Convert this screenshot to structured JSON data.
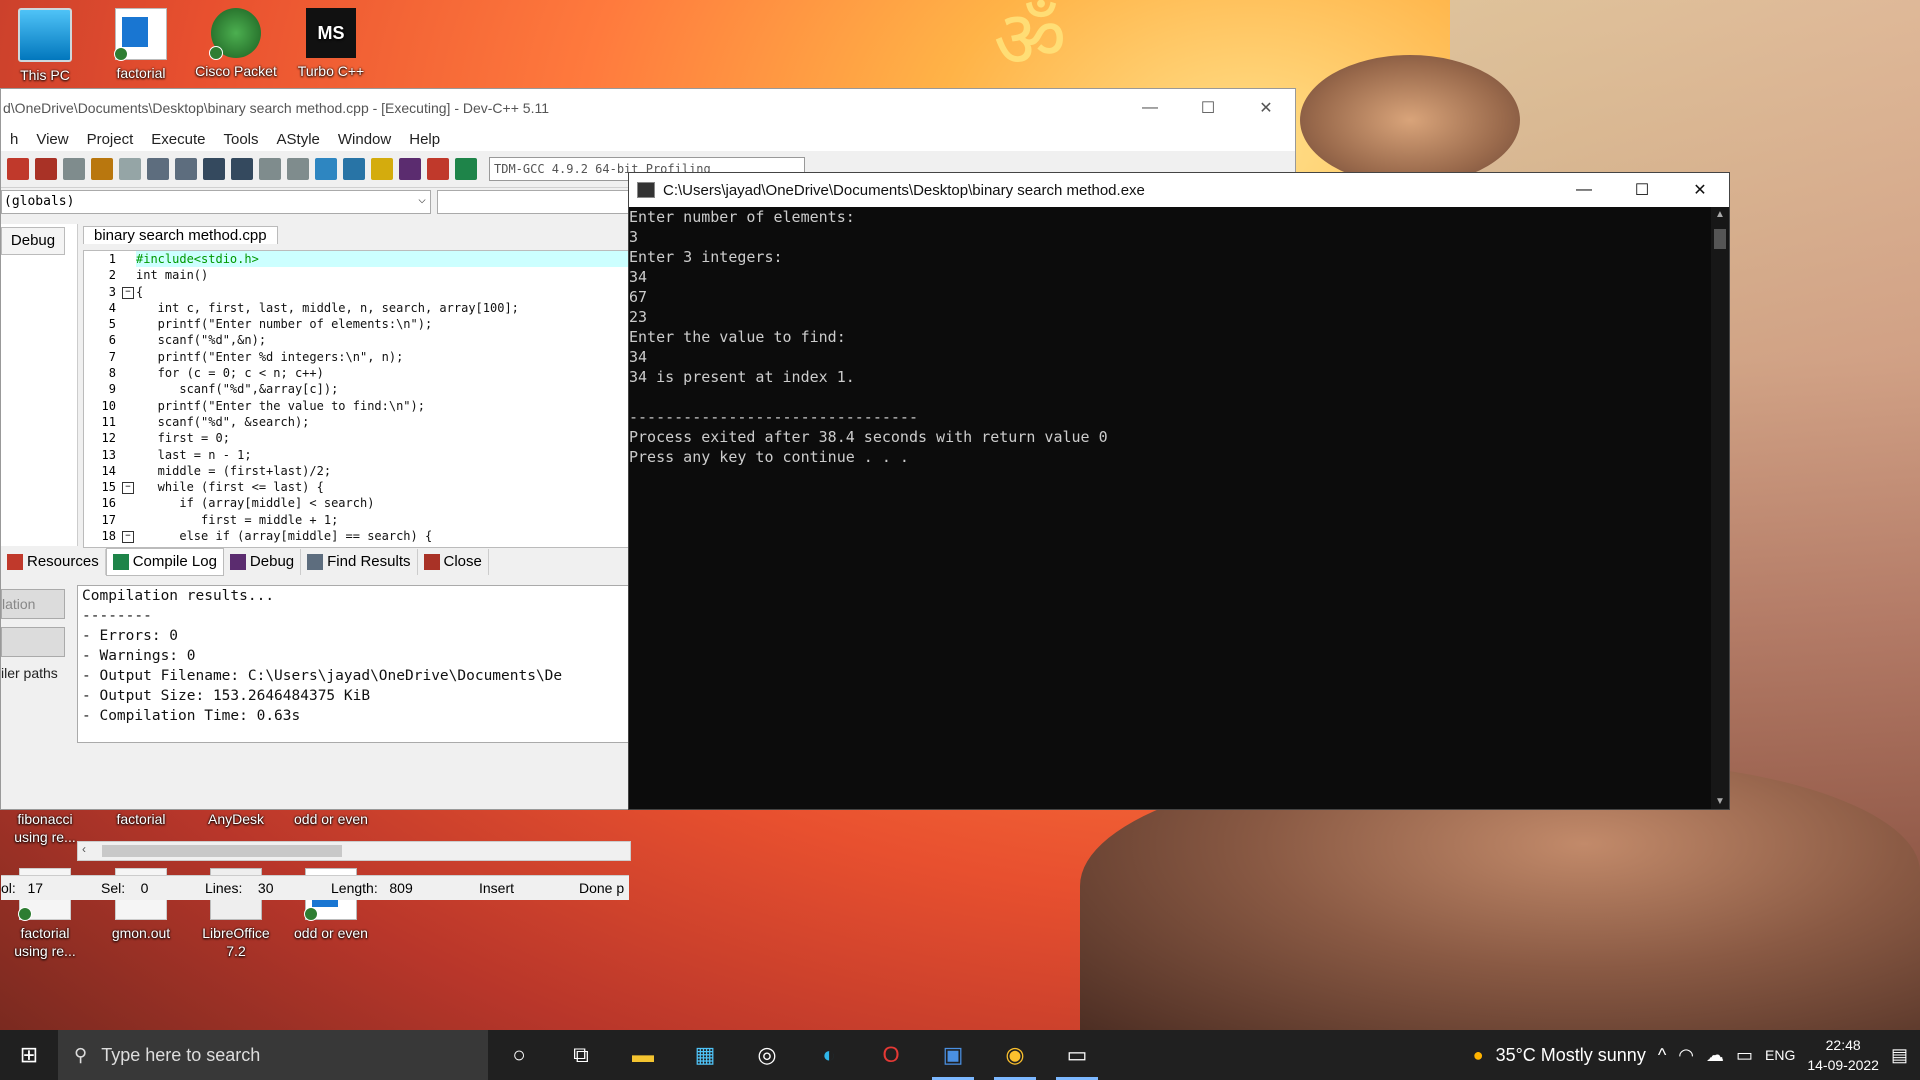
{
  "desktop": {
    "icons_top": [
      {
        "label": "This PC",
        "icon": "computer-icon"
      },
      {
        "label": "factorial",
        "icon": "document-icon"
      },
      {
        "label": "Cisco Packet",
        "icon": "cisco-icon"
      },
      {
        "label": "Turbo C++",
        "icon": "turbo-cpp-icon"
      }
    ],
    "icons_mid": [
      {
        "label": "fibonacci using re...",
        "icon": "file-icon"
      },
      {
        "label": "factorial",
        "icon": "file-icon"
      },
      {
        "label": "AnyDesk",
        "icon": "anydesk-icon"
      },
      {
        "label": "odd or even",
        "icon": "file-icon"
      }
    ],
    "icons_bottom": [
      {
        "label": "factorial using re...",
        "icon": "devcpp-file-icon"
      },
      {
        "label": "gmon.out",
        "icon": "file-icon"
      },
      {
        "label": "LibreOffice 7.2",
        "icon": "libreoffice-icon"
      },
      {
        "label": "odd or even",
        "icon": "document-icon"
      }
    ]
  },
  "devcpp": {
    "title": "d\\OneDrive\\Documents\\Desktop\\binary search method.cpp - [Executing] - Dev-C++ 5.11",
    "menu": [
      "h",
      "View",
      "Project",
      "Execute",
      "Tools",
      "AStyle",
      "Window",
      "Help"
    ],
    "compiler": "TDM-GCC 4.9.2 64-bit Profiling",
    "globals": "(globals)",
    "left_tab": "Debug",
    "editor_tab": "binary search method.cpp",
    "line_numbers": [
      "1",
      "2",
      "3",
      "4",
      "5",
      "6",
      "7",
      "8",
      "9",
      "10",
      "11",
      "12",
      "13",
      "14",
      "15",
      "16",
      "17",
      "18"
    ],
    "code_lines": [
      "#include<stdio.h>",
      "int main()",
      "{",
      "   int c, first, last, middle, n, search, array[100];",
      "   printf(\"Enter number of elements:\\n\");",
      "   scanf(\"%d\",&n);",
      "   printf(\"Enter %d integers:\\n\", n);",
      "   for (c = 0; c < n; c++)",
      "      scanf(\"%d\",&array[c]);",
      "   printf(\"Enter the value to find:\\n\");",
      "   scanf(\"%d\", &search);",
      "   first = 0;",
      "   last = n - 1;",
      "   middle = (first+last)/2;",
      "   while (first <= last) {",
      "      if (array[middle] < search)",
      "         first = middle + 1;",
      "      else if (array[middle] == search) {"
    ],
    "bottom_tabs": [
      "Resources",
      "Compile Log",
      "Debug",
      "Find Results",
      "Close"
    ],
    "bottom_left": [
      "lation",
      "iler paths"
    ],
    "compile_log": [
      "Compilation results...",
      "--------",
      "- Errors: 0",
      "- Warnings: 0",
      "- Output Filename: C:\\Users\\jayad\\OneDrive\\Documents\\De",
      "- Output Size: 153.2646484375 KiB",
      "- Compilation Time: 0.63s"
    ],
    "status": {
      "col": "ol:   17",
      "sel": "Sel:    0",
      "lines": "Lines:    30",
      "length": "Length:   809",
      "mode": "Insert",
      "done": "Done p"
    }
  },
  "console": {
    "title": "C:\\Users\\jayad\\OneDrive\\Documents\\Desktop\\binary search method.exe",
    "lines": [
      "Enter number of elements:",
      "3",
      "Enter 3 integers:",
      "34",
      "67",
      "23",
      "Enter the value to find:",
      "34",
      "34 is present at index 1.",
      "",
      "--------------------------------",
      "Process exited after 38.4 seconds with return value 0",
      "Press any key to continue . . ."
    ]
  },
  "taskbar": {
    "search_placeholder": "Type here to search",
    "weather": "35°C  Mostly sunny",
    "lang": "ENG",
    "time": "22:48",
    "date": "14-09-2022"
  }
}
